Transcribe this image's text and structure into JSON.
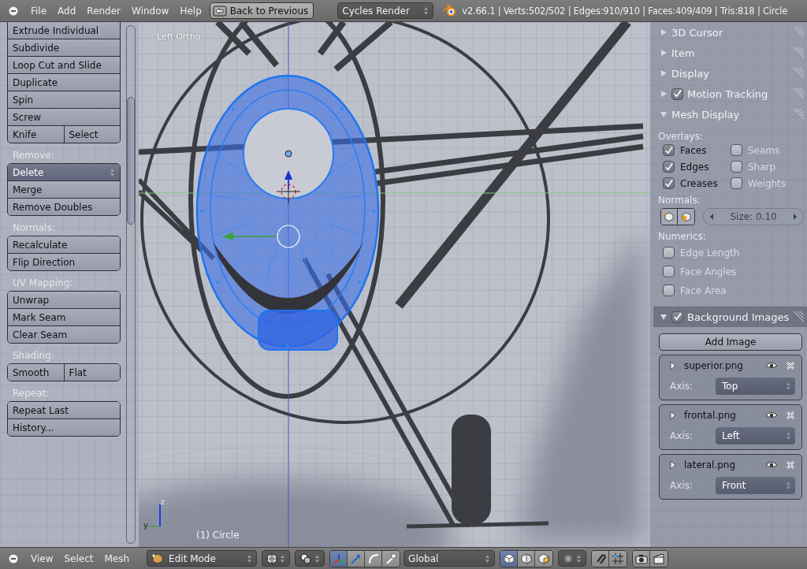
{
  "menu_bar": {
    "menus": [
      "File",
      "Add",
      "Render",
      "Window",
      "Help"
    ],
    "back_button": "Back to Previous",
    "render_engine": "Cycles Render",
    "stats": "v2.66.1 | Verts:502/502 | Edges:910/910 | Faces:409/409 | Tris:818 | Circle"
  },
  "tool_shelf": {
    "groups": [
      {
        "rows": [
          [
            {
              "label": "Extrude Individual",
              "kind": "button"
            }
          ],
          [
            {
              "label": "Subdivide",
              "kind": "button"
            }
          ],
          [
            {
              "label": "Loop Cut and Slide",
              "kind": "button"
            }
          ],
          [
            {
              "label": "Duplicate",
              "kind": "button"
            }
          ],
          [
            {
              "label": "Spin",
              "kind": "button"
            }
          ],
          [
            {
              "label": "Screw",
              "kind": "button"
            }
          ],
          [
            {
              "label": "Knife",
              "kind": "button"
            },
            {
              "label": "Select",
              "kind": "button"
            }
          ]
        ]
      },
      {
        "label": "Remove:",
        "rows": [
          [
            {
              "label": "Delete",
              "kind": "dropdown"
            }
          ],
          [
            {
              "label": "Merge",
              "kind": "button"
            }
          ],
          [
            {
              "label": "Remove Doubles",
              "kind": "button"
            }
          ]
        ]
      },
      {
        "label": "Normals:",
        "rows": [
          [
            {
              "label": "Recalculate",
              "kind": "button"
            }
          ],
          [
            {
              "label": "Flip Direction",
              "kind": "button"
            }
          ]
        ]
      },
      {
        "label": "UV Mapping:",
        "rows": [
          [
            {
              "label": "Unwrap",
              "kind": "button"
            }
          ],
          [
            {
              "label": "Mark Seam",
              "kind": "button"
            }
          ],
          [
            {
              "label": "Clear Seam",
              "kind": "button"
            }
          ]
        ]
      },
      {
        "label": "Shading:",
        "rows": [
          [
            {
              "label": "Smooth",
              "kind": "button"
            },
            {
              "label": "Flat",
              "kind": "button"
            }
          ]
        ]
      },
      {
        "label": "Repeat:",
        "rows": [
          [
            {
              "label": "Repeat Last",
              "kind": "button"
            }
          ],
          [
            {
              "label": "History...",
              "kind": "button"
            }
          ]
        ]
      }
    ]
  },
  "viewport": {
    "view_name": "Left Ortho",
    "object_label": "(1) Circle",
    "axis_labels": [
      "z",
      "y"
    ]
  },
  "properties_panel": {
    "panels": [
      {
        "title": "3D Cursor",
        "kind": "collapsed",
        "expanded": false
      },
      {
        "title": "Item",
        "kind": "collapsed",
        "expanded": false
      },
      {
        "title": "Display",
        "kind": "collapsed",
        "expanded": false
      },
      {
        "title": "Motion Tracking",
        "kind": "collapsed",
        "expanded": false,
        "checked": true
      },
      {
        "title": "Mesh Display",
        "kind": "mesh_display",
        "expanded": true,
        "overlays_label": "Overlays:",
        "overlays": [
          {
            "label": "Faces",
            "checked": true
          },
          {
            "label": "Seams",
            "checked": false
          },
          {
            "label": "Edges",
            "checked": true
          },
          {
            "label": "Sharp",
            "checked": false
          },
          {
            "label": "Creases",
            "checked": true
          },
          {
            "label": "Weights",
            "checked": false
          }
        ],
        "normals_label": "Normals:",
        "size_field": "Size: 0.10",
        "numerics_label": "Numerics:",
        "numerics": [
          {
            "label": "Edge Length",
            "checked": false
          },
          {
            "label": "Face Angles",
            "checked": false
          },
          {
            "label": "Face Area",
            "checked": false
          }
        ]
      },
      {
        "title": "Background Images",
        "kind": "background_images",
        "expanded": true,
        "checked": true,
        "add_button": "Add Image",
        "images": [
          {
            "name": "superior.png",
            "axis_label": "Axis:",
            "axis": "Top"
          },
          {
            "name": "frontal.png",
            "axis_label": "Axis:",
            "axis": "Left"
          },
          {
            "name": "lateral.png",
            "axis_label": "Axis:",
            "axis": "Front"
          }
        ]
      }
    ]
  },
  "bottom_bar": {
    "menus": [
      "View",
      "Select",
      "Mesh"
    ],
    "mode": "Edit Mode",
    "orientation": "Global",
    "select_modes": [
      {
        "selected": true
      },
      {
        "selected": false
      },
      {
        "selected": false
      }
    ]
  }
}
